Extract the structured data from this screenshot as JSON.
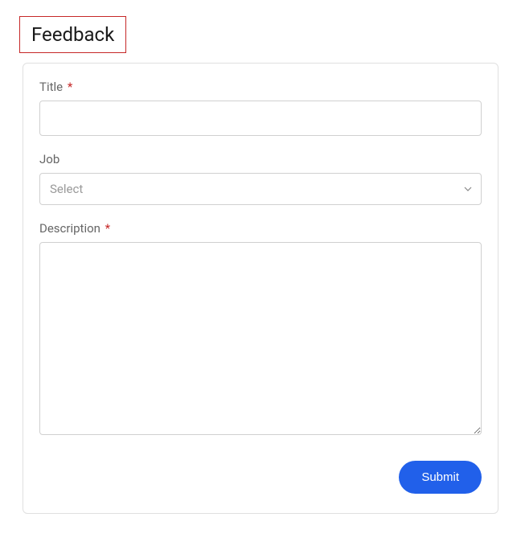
{
  "page": {
    "title": "Feedback"
  },
  "form": {
    "fields": {
      "title": {
        "label": "Title",
        "required": true,
        "value": ""
      },
      "job": {
        "label": "Job",
        "required": false,
        "placeholder": "Select",
        "value": ""
      },
      "description": {
        "label": "Description",
        "required": true,
        "value": ""
      }
    },
    "submit_label": "Submit"
  },
  "colors": {
    "accent": "#2160ea",
    "required": "#c62828",
    "border": "#d0d0d0",
    "label": "#666666"
  }
}
